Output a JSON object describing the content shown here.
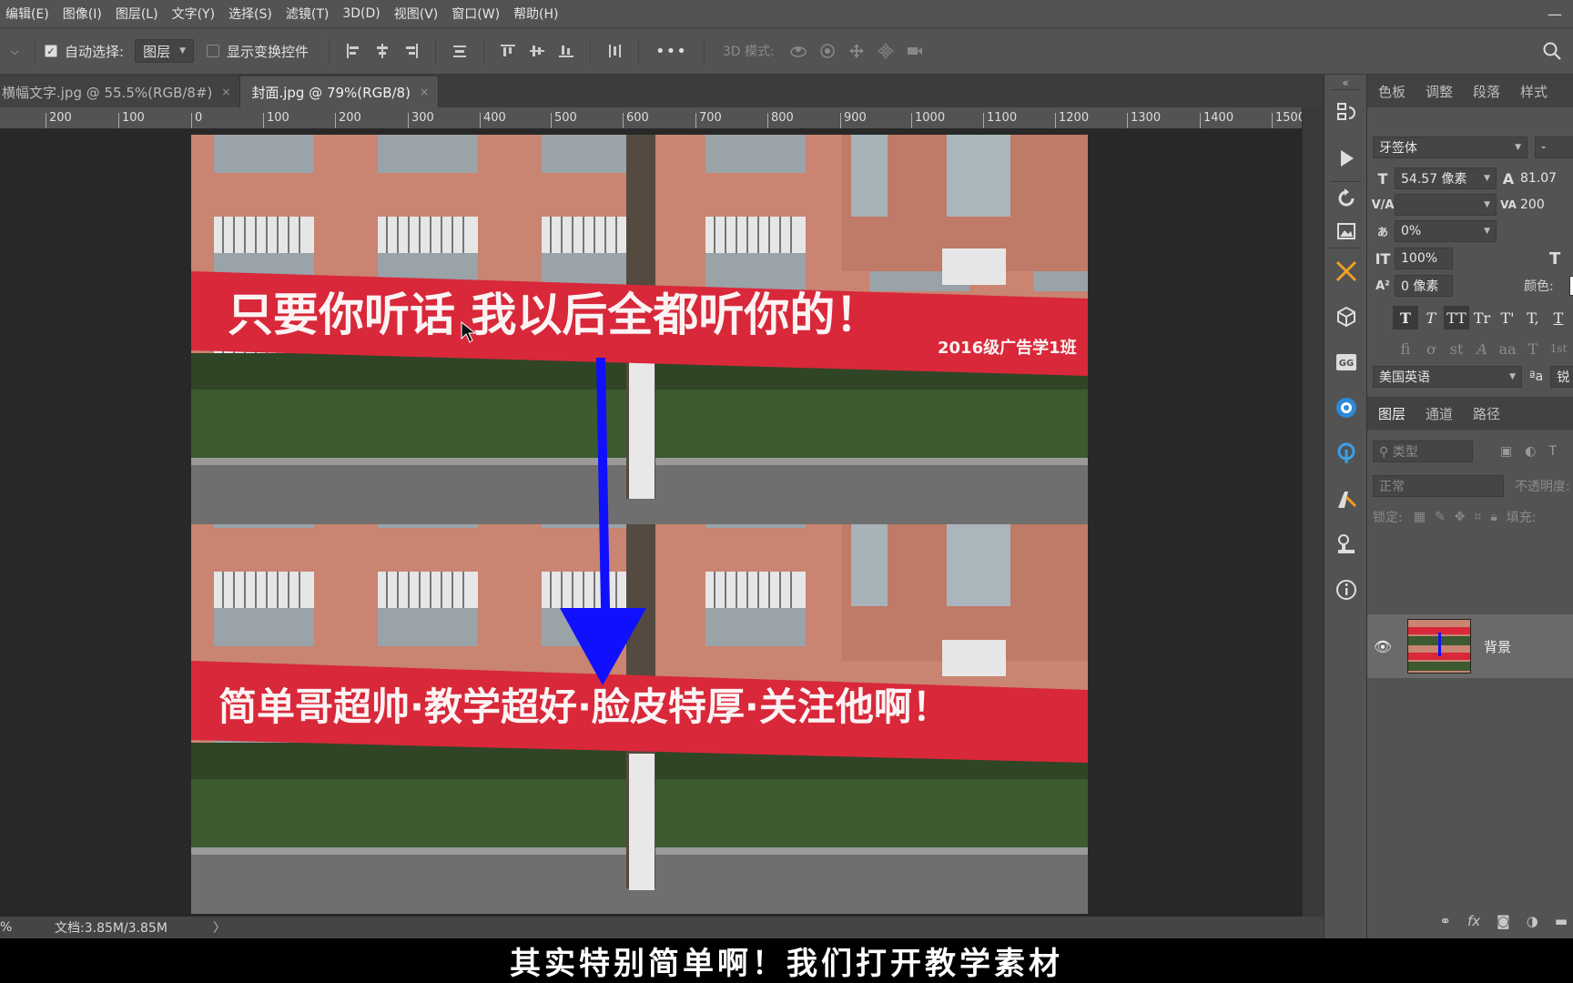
{
  "menu": {
    "items": [
      "编辑(E)",
      "图像(I)",
      "图层(L)",
      "文字(Y)",
      "选择(S)",
      "滤镜(T)",
      "3D(D)",
      "视图(V)",
      "窗口(W)",
      "帮助(H)"
    ]
  },
  "options": {
    "auto_select_label": "自动选择:",
    "auto_select_checked": true,
    "auto_select_target": "图层",
    "show_transform_label": "显示变换控件",
    "show_transform_checked": false,
    "more": "•••",
    "mode_3d_label": "3D 模式:"
  },
  "tabs": [
    {
      "title": "横幅文字.jpg @ 55.5%(RGB/8#)",
      "close": "×",
      "active": false
    },
    {
      "title": "封面.jpg @ 79%(RGB/8)",
      "close": "×",
      "active": true
    }
  ],
  "ruler": {
    "ticks": [
      "200",
      "100",
      "0",
      "100",
      "200",
      "300",
      "400",
      "500",
      "600",
      "700",
      "800",
      "900",
      "1000",
      "1100",
      "1200",
      "1300",
      "1400",
      "1500"
    ]
  },
  "photo": {
    "banner_top_text": "只要你听话  我以后全都听你的！",
    "banner_top_small": "2016级广告学1班",
    "banner_bottom_text": "简单哥超帅·教学超好·脸皮特厚·关注他啊！",
    "arrow_color": "#1010ff",
    "banner_color": "#d8283a",
    "wall_color": "#c9836f"
  },
  "status": {
    "zoom": "%",
    "doc_info": "文档:3.85M/3.85M",
    "arrow": "〉"
  },
  "subtitle": "其实特别简单啊！我们打开教学素材",
  "panel": {
    "top_tabs": [
      "色板",
      "调整",
      "段落",
      "样式"
    ],
    "font_family": "牙签体",
    "font_style": "-",
    "font_size": "54.57 像素",
    "leading": "81.07",
    "kerning": "",
    "tracking": "200",
    "scale_pct": "0%",
    "vscale": "100%",
    "hscale_icon": "T",
    "baseline": "0 像素",
    "color_label": "颜色:",
    "type_styles": [
      "T",
      "T",
      "TT",
      "Tr",
      "T'",
      "T,",
      "T"
    ],
    "opentype": [
      "fi",
      "ơ",
      "st",
      "A",
      "aa",
      "T",
      "1st"
    ],
    "language": "美国英语",
    "aa_label": "ªa",
    "aa_value": "锐"
  },
  "layers": {
    "tabs": [
      "图层",
      "通道",
      "路径"
    ],
    "filter_placeholder": "类型",
    "blend_mode": "正常",
    "opacity_label": "不透明度:",
    "lock_label": "锁定:",
    "fill_label": "填充:",
    "layer_name": "背景"
  }
}
